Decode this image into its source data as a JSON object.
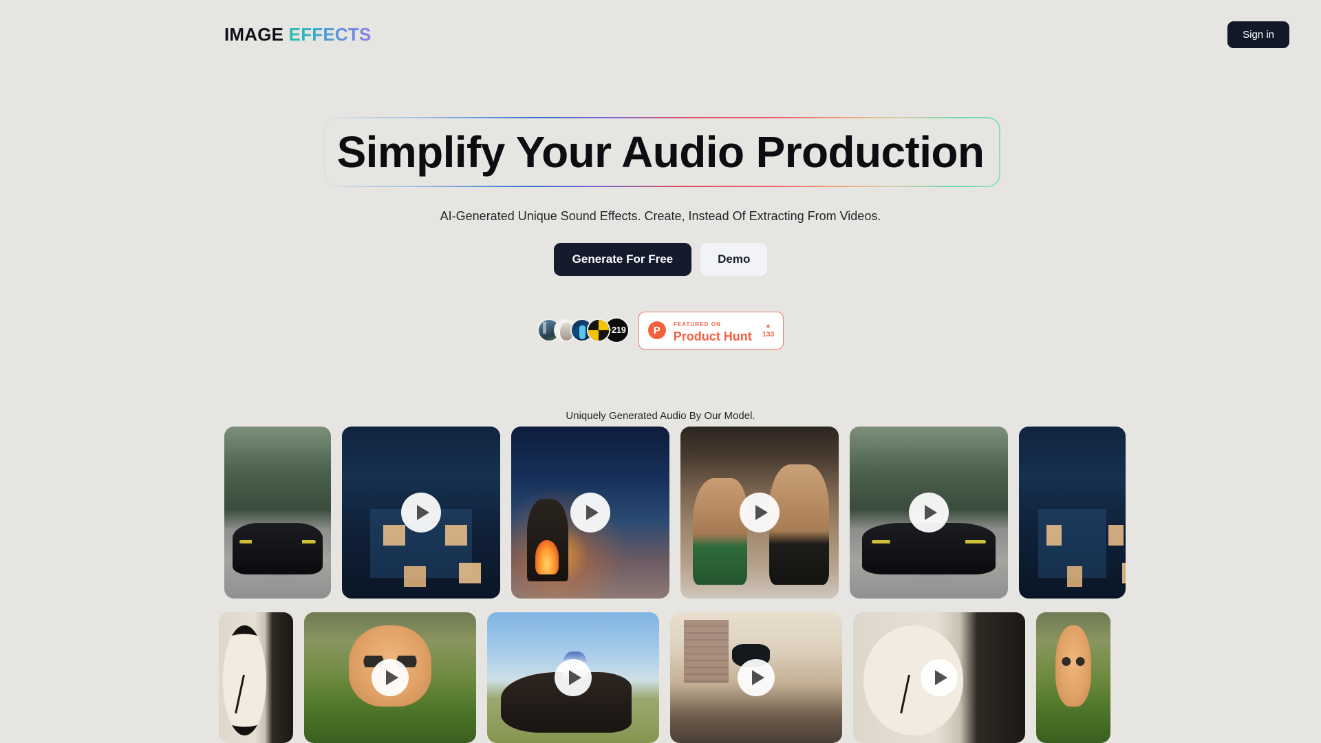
{
  "header": {
    "logo_part1": "IMAGE",
    "logo_part2": "EFFECTS",
    "signin_label": "Sign in"
  },
  "hero": {
    "headline": "Simplify Your Audio Production",
    "subtitle": "AI-Generated Unique Sound Effects. Create, Instead Of Extracting From Videos.",
    "primary_cta": "Generate For Free",
    "secondary_cta": "Demo"
  },
  "social_proof": {
    "avatar_overflow": "+219",
    "avatars": [
      {
        "name": "avatar-photo-person"
      },
      {
        "name": "avatar-sketch-portrait"
      },
      {
        "name": "avatar-blue-character"
      },
      {
        "name": "avatar-yellow-pinwheel"
      }
    ],
    "product_hunt": {
      "logo_letter": "P",
      "featured_label": "FEATURED ON",
      "name": "Product Hunt",
      "caret": "▲",
      "upvotes": "133",
      "accent_color": "#f4613f"
    }
  },
  "gallery": {
    "caption": "Uniquely Generated Audio By Our Model.",
    "row1": [
      {
        "label": "black-sports-car-forest-road",
        "art": "art-car",
        "narrow": true
      },
      {
        "label": "anime-night-house-rain",
        "art": "art-night",
        "narrow": false
      },
      {
        "label": "cozy-cabin-fireplace-snow",
        "art": "art-fire",
        "narrow": false
      },
      {
        "label": "mma-fighters-octagon",
        "art": "art-mma",
        "narrow": false
      },
      {
        "label": "black-sports-car-forest-road",
        "art": "art-car",
        "narrow": false
      },
      {
        "label": "anime-night-house-rain",
        "art": "art-night",
        "narrow": true
      }
    ],
    "row2": [
      {
        "label": "clock-on-wall",
        "art": "art-clock",
        "narrow": true
      },
      {
        "label": "orange-kitten-in-grass",
        "art": "art-kitten",
        "narrow": false
      },
      {
        "label": "horse-rider-galloping",
        "art": "art-horse",
        "narrow": false
      },
      {
        "label": "cat-robot-restaurant",
        "art": "art-robot",
        "narrow": false
      },
      {
        "label": "wall-clock-classroom",
        "art": "art-clock",
        "narrow": false
      },
      {
        "label": "orange-kitten-in-grass",
        "art": "art-kitten",
        "narrow": true
      }
    ]
  },
  "colors": {
    "page_background": "#e7e5e1",
    "dark_button": "#141b2d",
    "logo_gradient_start": "#24bfae",
    "logo_gradient_end": "#8b7ee8"
  }
}
